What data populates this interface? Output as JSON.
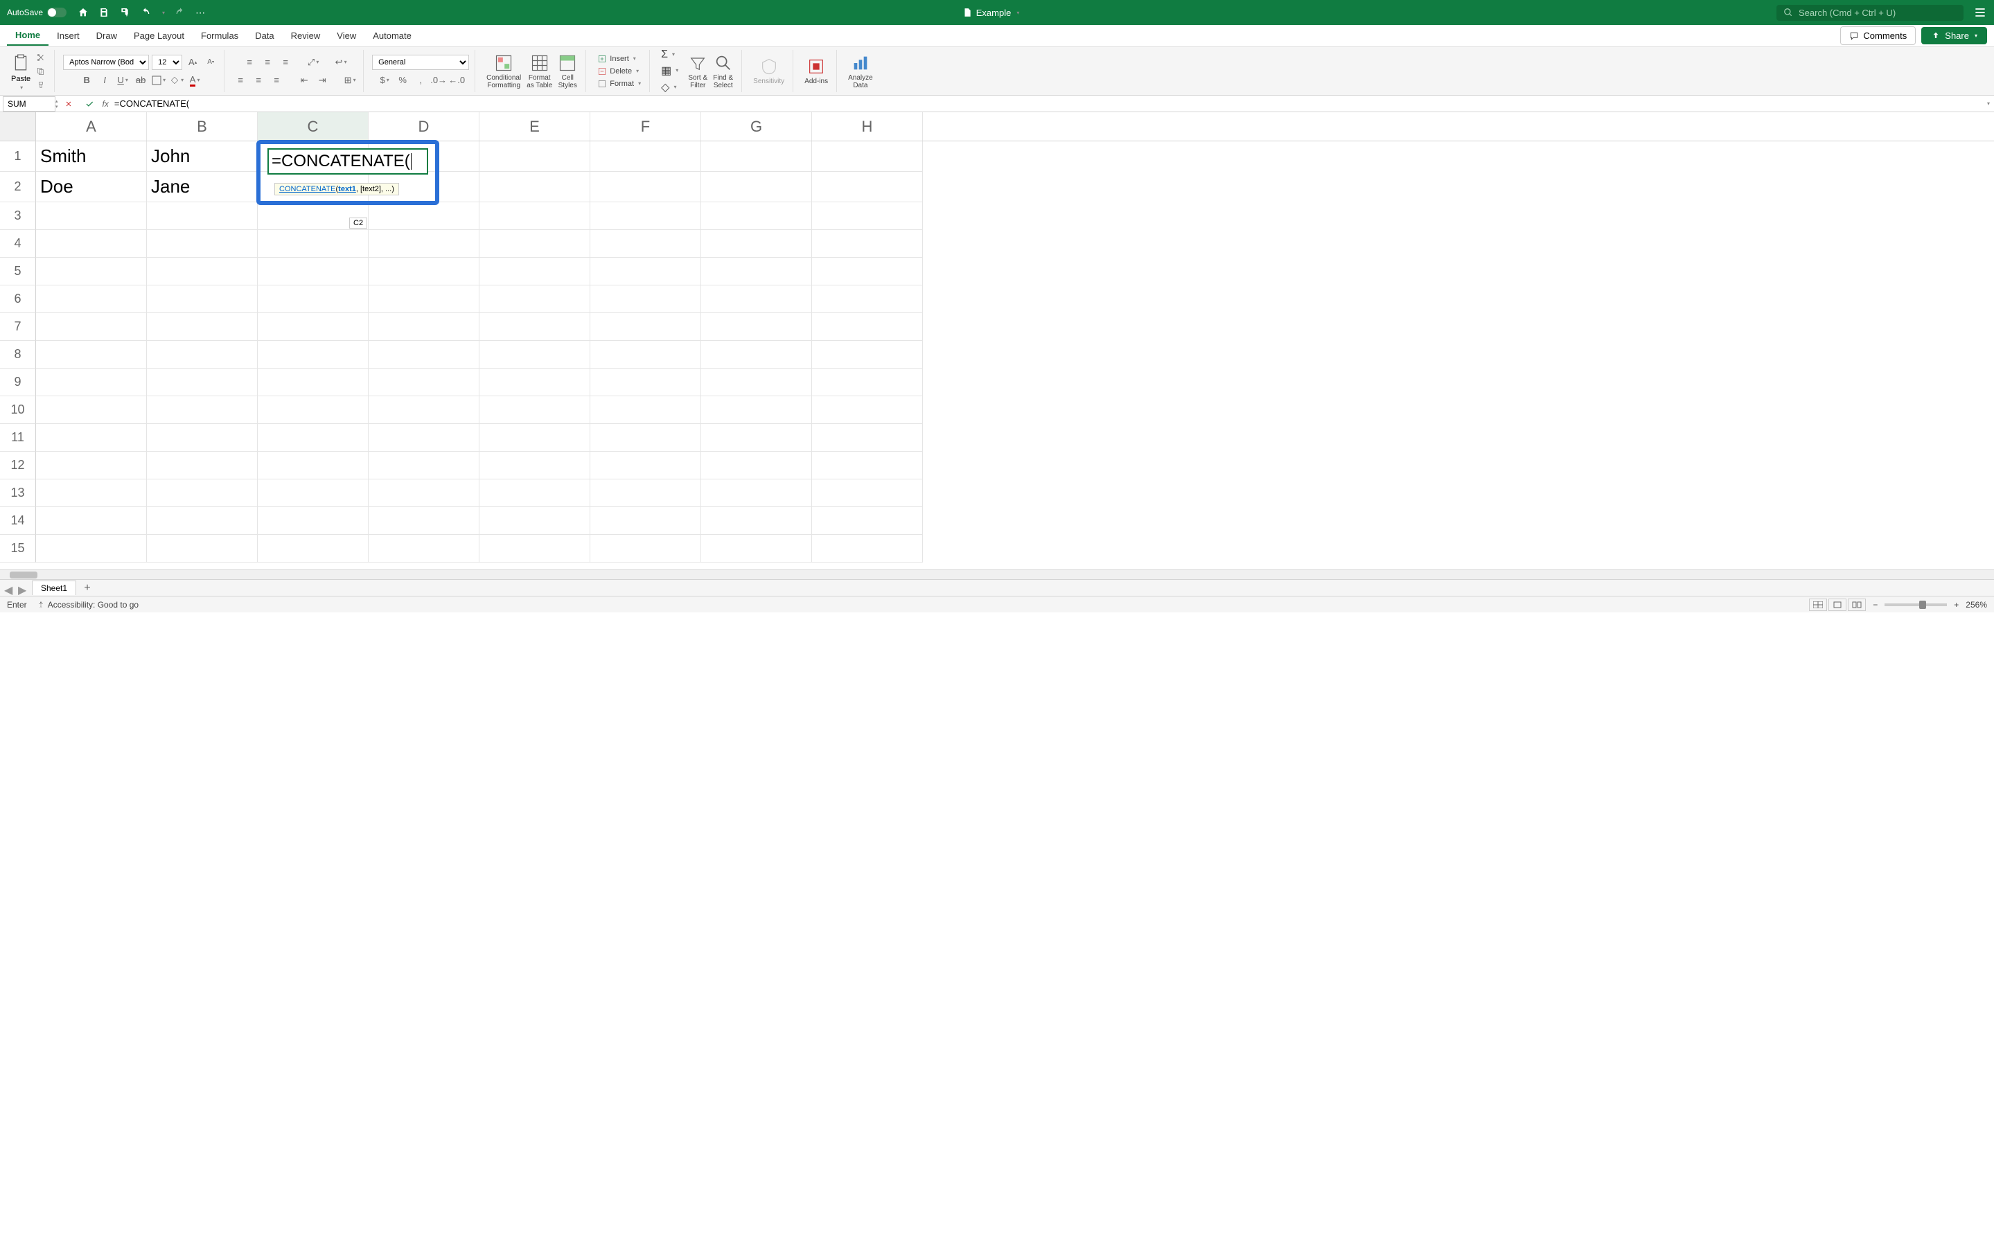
{
  "titleBar": {
    "autosave": "AutoSave",
    "docTitle": "Example",
    "searchPlaceholder": "Search (Cmd + Ctrl + U)"
  },
  "tabs": [
    "Home",
    "Insert",
    "Draw",
    "Page Layout",
    "Formulas",
    "Data",
    "Review",
    "View",
    "Automate"
  ],
  "activeTab": "Home",
  "commentsBtn": "Comments",
  "shareBtn": "Share",
  "ribbon": {
    "paste": "Paste",
    "fontName": "Aptos Narrow (Bod...",
    "fontSize": "12",
    "numberFormat": "General",
    "conditionalFormatting": "Conditional\nFormatting",
    "formatAsTable": "Format\nas Table",
    "cellStyles": "Cell\nStyles",
    "insert": "Insert",
    "delete": "Delete",
    "format": "Format",
    "sortFilter": "Sort &\nFilter",
    "findSelect": "Find &\nSelect",
    "sensitivity": "Sensitivity",
    "addins": "Add-ins",
    "analyzeData": "Analyze\nData"
  },
  "formulaBar": {
    "nameBox": "SUM",
    "formula": "=CONCATENATE("
  },
  "columns": [
    "A",
    "B",
    "C",
    "D",
    "E",
    "F",
    "G",
    "H"
  ],
  "rows": [
    1,
    2,
    3,
    4,
    5,
    6,
    7,
    8,
    9,
    10,
    11,
    12,
    13,
    14,
    15
  ],
  "cells": {
    "A1": "Smith",
    "B1": "John",
    "A2": "Doe",
    "B2": "Jane"
  },
  "editingCell": {
    "address": "C1",
    "value": "=CONCATENATE(",
    "tooltip": {
      "fn": "CONCATENATE",
      "open": "(",
      "arg1": "text1",
      "rest": ", [text2], ...)"
    },
    "refBadge": "C2"
  },
  "sheetTabs": [
    "Sheet1"
  ],
  "statusBar": {
    "mode": "Enter",
    "accessibility": "Accessibility: Good to go",
    "zoom": "256%"
  }
}
